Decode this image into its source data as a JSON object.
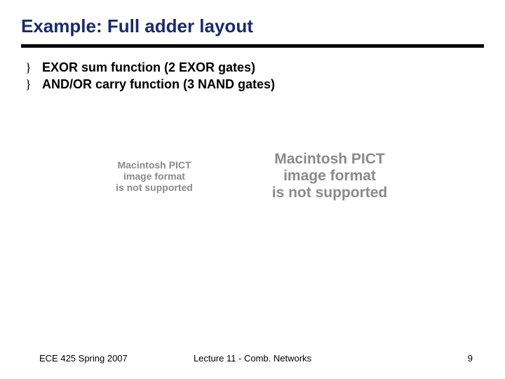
{
  "title": "Example: Full adder layout",
  "bullets": [
    "EXOR sum function (2 EXOR gates)",
    "AND/OR carry function (3 NAND gates)"
  ],
  "placeholder": {
    "line1": "Macintosh PICT",
    "line2": "image format",
    "line3": "is not supported"
  },
  "footer": {
    "left": "ECE 425 Spring 2007",
    "center": "Lecture 11 - Comb. Networks",
    "right": "9"
  }
}
